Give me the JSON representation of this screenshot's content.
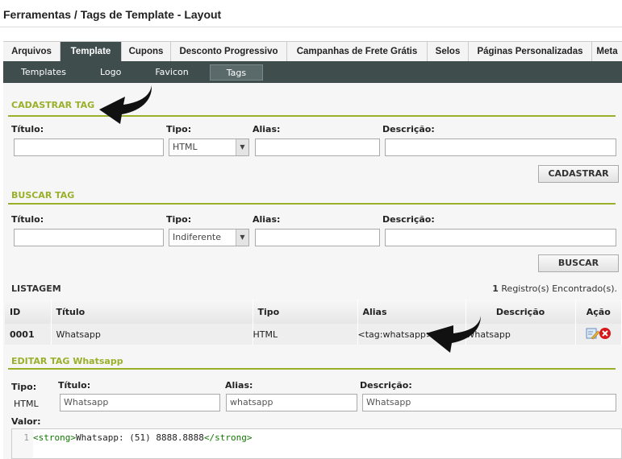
{
  "title": "Ferramentas / Tags de Template - Layout",
  "tabs": [
    {
      "label": "Arquivos"
    },
    {
      "label": "Template",
      "active": true
    },
    {
      "label": "Cupons"
    },
    {
      "label": "Desconto Progressivo"
    },
    {
      "label": "Campanhas de Frete Grátis"
    },
    {
      "label": "Selos"
    },
    {
      "label": "Páginas Personalizadas"
    },
    {
      "label": "Meta"
    }
  ],
  "subnav": [
    {
      "label": "Templates"
    },
    {
      "label": "Logo"
    },
    {
      "label": "Favicon"
    },
    {
      "label": "Tags",
      "active": true
    }
  ],
  "cadastrar": {
    "heading": "CADASTRAR TAG",
    "titulo_label": "Título:",
    "tipo_label": "Tipo:",
    "alias_label": "Alias:",
    "descricao_label": "Descrição:",
    "tipo_value": "HTML",
    "titulo_value": "",
    "alias_value": "",
    "descricao_value": "",
    "button": "CADASTRAR"
  },
  "buscar": {
    "heading": "BUSCAR TAG",
    "titulo_label": "Título:",
    "tipo_label": "Tipo:",
    "alias_label": "Alias:",
    "descricao_label": "Descrição:",
    "tipo_value": "Indiferente",
    "button": "BUSCAR"
  },
  "listagem": {
    "heading": "LISTAGEM",
    "count": "1",
    "count_suffix": " Registro(s) Encontrado(s).",
    "columns": [
      "ID",
      "Título",
      "Tipo",
      "Alias",
      "Descrição",
      "Ação"
    ],
    "rows": [
      {
        "id": "0001",
        "titulo": "Whatsapp",
        "tipo": "HTML",
        "alias": "<tag:whatsapp>",
        "descricao": "Whatsapp"
      }
    ]
  },
  "editar": {
    "heading": "EDITAR TAG Whatsapp",
    "tipo_label": "Tipo:",
    "tipo_value": "HTML",
    "titulo_label": "Título:",
    "titulo_value": "Whatsapp",
    "alias_label": "Alias:",
    "alias_value": "whatsapp",
    "descricao_label": "Descrição:",
    "descricao_value": "Whatsapp",
    "valor_label": "Valor:",
    "code_line_number": "1",
    "code_open": "<strong>",
    "code_text": "Whatsapp: (51) 8888.8888",
    "code_close": "</strong>"
  },
  "colors": {
    "accent": "#9ab02a",
    "nav_dark": "#3f4d4d",
    "code_tag": "#117700"
  }
}
